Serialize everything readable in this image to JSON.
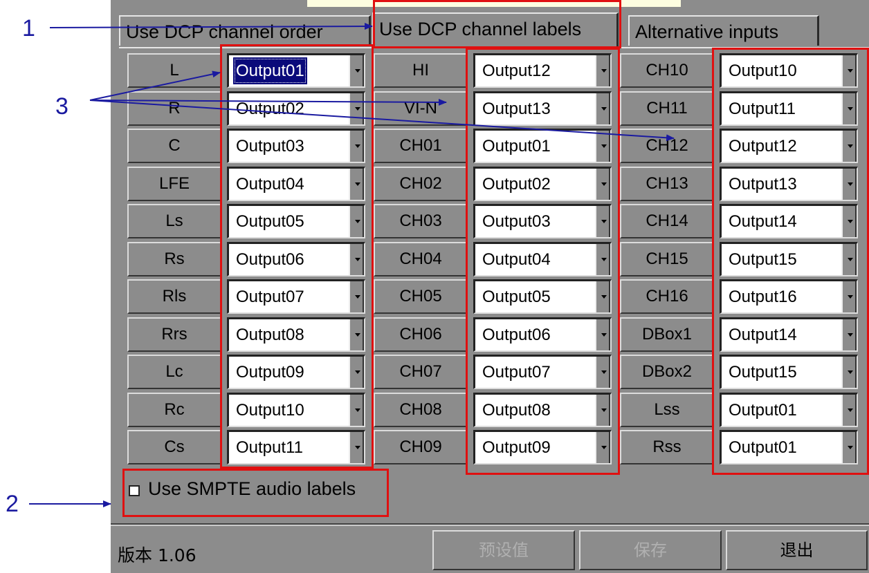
{
  "tabs": [
    {
      "label": "Use DCP channel order",
      "active": false
    },
    {
      "label": "Use DCP channel labels",
      "active": true
    },
    {
      "label": "Alternative inputs",
      "active": false
    }
  ],
  "columns": [
    {
      "rows": [
        {
          "label": "L",
          "output": "Output01",
          "selected": true
        },
        {
          "label": "R",
          "output": "Output02"
        },
        {
          "label": "C",
          "output": "Output03"
        },
        {
          "label": "LFE",
          "output": "Output04"
        },
        {
          "label": "Ls",
          "output": "Output05"
        },
        {
          "label": "Rs",
          "output": "Output06"
        },
        {
          "label": "Rls",
          "output": "Output07"
        },
        {
          "label": "Rrs",
          "output": "Output08"
        },
        {
          "label": "Lc",
          "output": "Output09"
        },
        {
          "label": "Rc",
          "output": "Output10"
        },
        {
          "label": "Cs",
          "output": "Output11"
        }
      ]
    },
    {
      "rows": [
        {
          "label": "HI",
          "output": "Output12"
        },
        {
          "label": "VI-N",
          "output": "Output13"
        },
        {
          "label": "CH01",
          "output": "Output01"
        },
        {
          "label": "CH02",
          "output": "Output02"
        },
        {
          "label": "CH03",
          "output": "Output03"
        },
        {
          "label": "CH04",
          "output": "Output04"
        },
        {
          "label": "CH05",
          "output": "Output05"
        },
        {
          "label": "CH06",
          "output": "Output06"
        },
        {
          "label": "CH07",
          "output": "Output07"
        },
        {
          "label": "CH08",
          "output": "Output08"
        },
        {
          "label": "CH09",
          "output": "Output09"
        }
      ]
    },
    {
      "rows": [
        {
          "label": "CH10",
          "output": "Output10"
        },
        {
          "label": "CH11",
          "output": "Output11"
        },
        {
          "label": "CH12",
          "output": "Output12"
        },
        {
          "label": "CH13",
          "output": "Output13"
        },
        {
          "label": "CH14",
          "output": "Output14"
        },
        {
          "label": "CH15",
          "output": "Output15"
        },
        {
          "label": "CH16",
          "output": "Output16"
        },
        {
          "label": "DBox1",
          "output": "Output14"
        },
        {
          "label": "DBox2",
          "output": "Output15"
        },
        {
          "label": "Lss",
          "output": "Output01"
        },
        {
          "label": "Rss",
          "output": "Output01"
        }
      ]
    }
  ],
  "smpte_checkbox": {
    "label": "Use SMPTE audio labels",
    "checked": false
  },
  "footer": {
    "version": "版本 1.06",
    "buttons": [
      {
        "label": "预设值",
        "enabled": false
      },
      {
        "label": "保存",
        "enabled": false
      },
      {
        "label": "退出",
        "enabled": true
      }
    ]
  },
  "annotations": {
    "one": "1",
    "two": "2",
    "three": "3"
  },
  "colors": {
    "panel": "#8c8c8c",
    "selection": "#0a0a7a",
    "highlight_box": "#e01010",
    "callout": "#1a1aa0"
  }
}
